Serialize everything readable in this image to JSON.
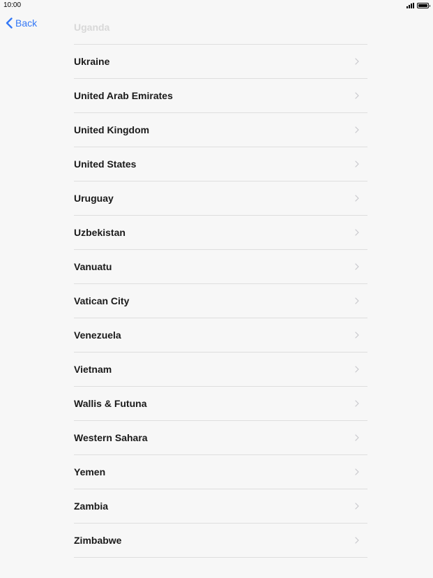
{
  "status_bar": {
    "time": "10:00"
  },
  "nav": {
    "back_label": "Back"
  },
  "countries": [
    "Uganda",
    "Ukraine",
    "United Arab Emirates",
    "United Kingdom",
    "United States",
    "Uruguay",
    "Uzbekistan",
    "Vanuatu",
    "Vatican City",
    "Venezuela",
    "Vietnam",
    "Wallis & Futuna",
    "Western Sahara",
    "Yemen",
    "Zambia",
    "Zimbabwe"
  ],
  "icons": {
    "back": "chevron-left-icon",
    "row": "chevron-right-icon",
    "signal": "signal-icon",
    "battery": "battery-icon"
  },
  "colors": {
    "accent": "#3478f6",
    "background": "#f7f7f7",
    "separator": "#dedede",
    "chevron": "#c7c7cc"
  }
}
